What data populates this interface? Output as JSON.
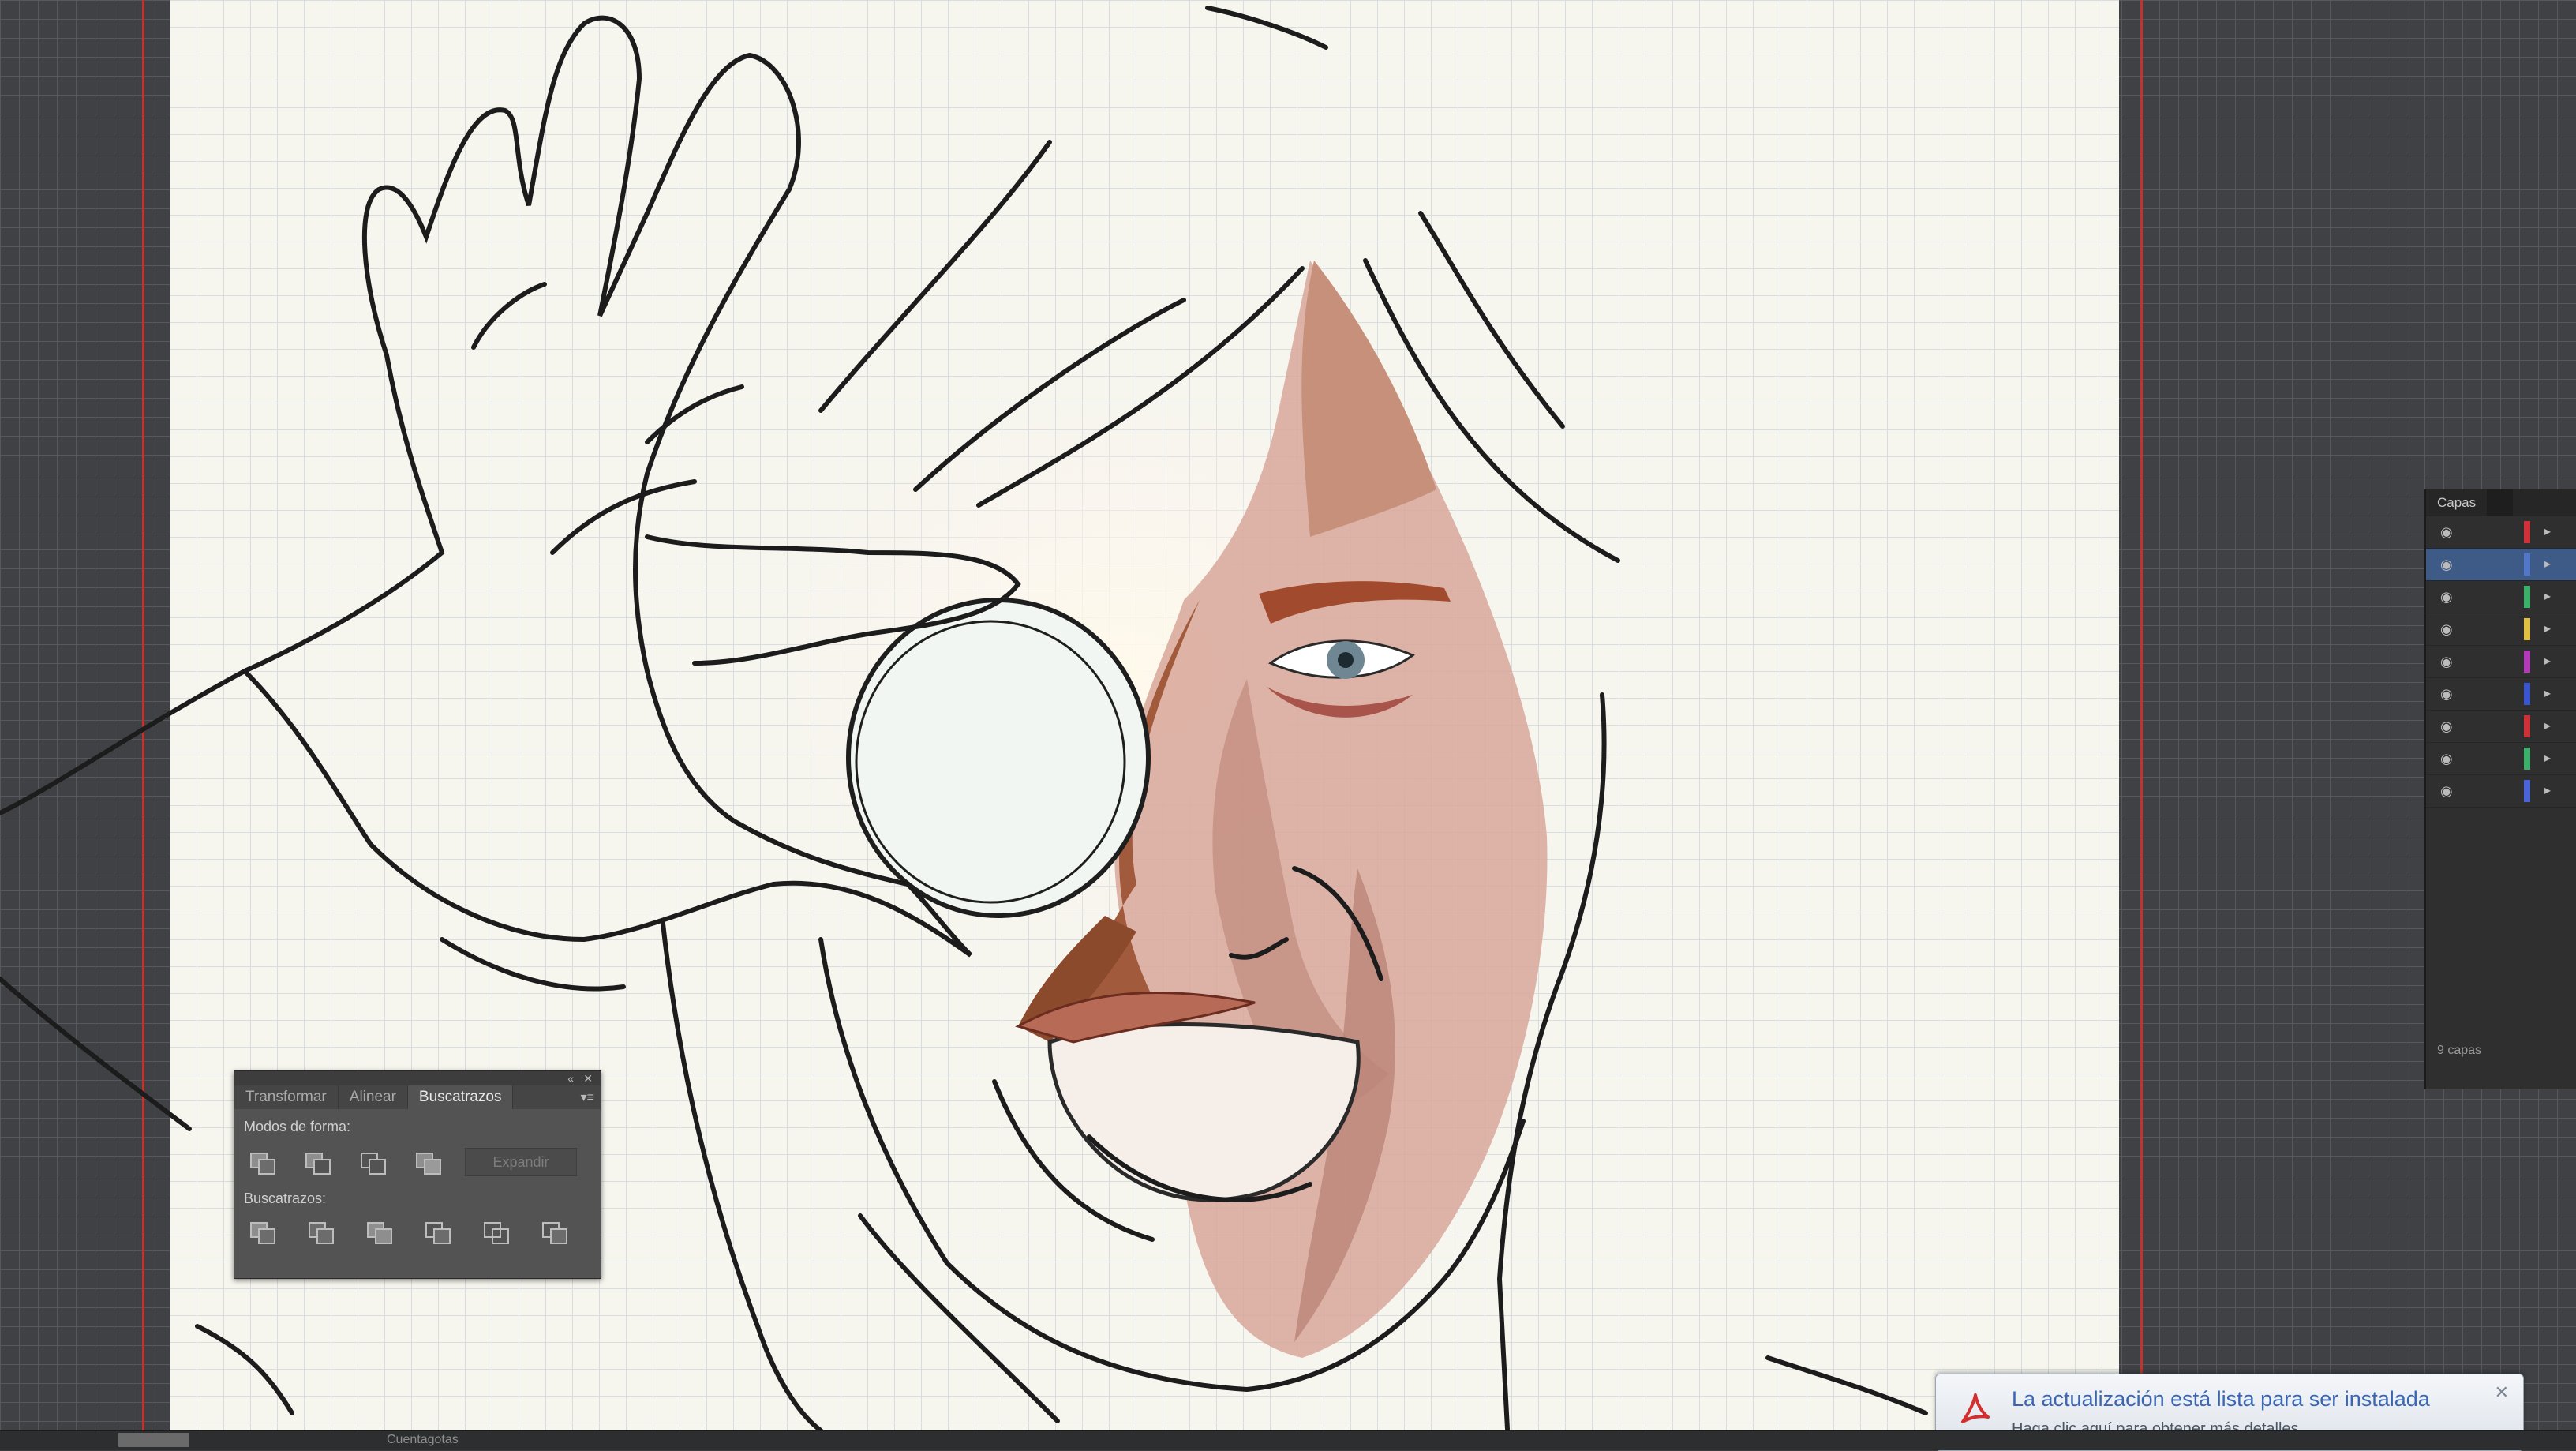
{
  "pathfinder_panel": {
    "tabs": [
      "Transformar",
      "Alinear",
      "Buscatrazos"
    ],
    "active_tab": "Buscatrazos",
    "shape_modes_label": "Modos de forma:",
    "expand_label": "Expandir",
    "pathfinders_label": "Buscatrazos:"
  },
  "layers_panel": {
    "tab": "Capas",
    "footer": "9 capas",
    "layer_colors": [
      "#d0303a",
      "#5277c8",
      "#3ab06a",
      "#e0c040",
      "#b23ab8",
      "#3a55d0",
      "#d0303a",
      "#3ab06a",
      "#4a63d8"
    ]
  },
  "notification": {
    "title": "La actualización está lista para ser instalada",
    "subtitle": "Haga clic aquí para obtener más detalles."
  },
  "status_bar": {
    "tool_text": "Cuentagotas"
  }
}
